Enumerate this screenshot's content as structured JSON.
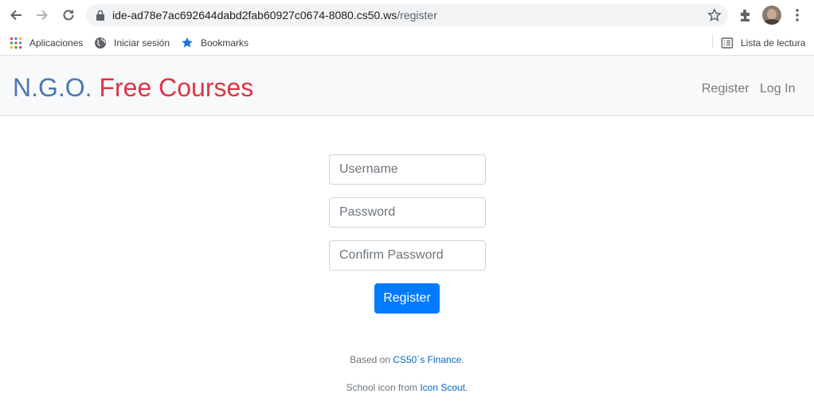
{
  "browser": {
    "url_host": "ide-ad78e7ac692644dabd2fab60927c0674-8080.cs50.ws",
    "url_path": "/register",
    "bookmarks": [
      {
        "label": "Aplicaciones",
        "icon": "apps-grid-icon"
      },
      {
        "label": "Iniciar sesión",
        "icon": "globe-icon"
      },
      {
        "label": "Bookmarks",
        "icon": "star-icon"
      }
    ],
    "reading_list": "Lista de lectura"
  },
  "navbar": {
    "brand_part1": "N.G.O.",
    "brand_part2": "Free Courses",
    "links": [
      "Register",
      "Log In"
    ]
  },
  "form": {
    "username_placeholder": "Username",
    "password_placeholder": "Password",
    "confirm_placeholder": "Confirm Password",
    "submit_label": "Register"
  },
  "footer": {
    "line1_prefix": "Based on ",
    "line1_link": "CS50´s Finance",
    "line1_suffix": ".",
    "line2_prefix": "School icon from ",
    "line2_link": "Icon Scout",
    "line2_suffix": "."
  },
  "colors": {
    "brand_blue": "#4a78b5",
    "brand_red": "#dc3545",
    "primary": "#007bff",
    "link": "#0067c5"
  }
}
